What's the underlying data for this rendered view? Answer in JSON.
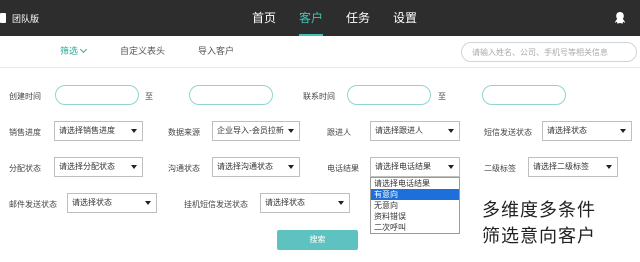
{
  "app": {
    "brand_label": "团队版"
  },
  "nav": [
    {
      "label": "首页"
    },
    {
      "label": "客户"
    },
    {
      "label": "任务"
    },
    {
      "label": "设置"
    }
  ],
  "subnav": {
    "filter": "筛选",
    "custom_header": "自定义表头",
    "import": "导入客户",
    "search_placeholder": "请输入姓名、公司、手机号等相关信息"
  },
  "filters": {
    "created_time": "创建时间",
    "contact_time": "联系时间",
    "to": "至",
    "sales_progress": {
      "label": "销售进度",
      "value": "请选择销售进度"
    },
    "data_source": {
      "label": "数据来源",
      "value": "企业导入-会员拉新"
    },
    "follower": {
      "label": "跟进人",
      "value": "请选择跟进人"
    },
    "sms_status": {
      "label": "短信发送状态",
      "value": "请选择状态"
    },
    "assign_status": {
      "label": "分配状态",
      "value": "请选择分配状态"
    },
    "comm_status": {
      "label": "沟通状态",
      "value": "请选择沟通状态"
    },
    "call_result": {
      "label": "电话结果",
      "value": "请选择电话结果"
    },
    "secondary_tag": {
      "label": "二级标签",
      "value": "请选择二级标签"
    },
    "mail_status": {
      "label": "邮件发送状态",
      "value": "请选择状态"
    },
    "robot_sms_status": {
      "label": "挂机短信发送状态",
      "value": "请选择状态"
    }
  },
  "dropdown": {
    "options": [
      "请选择电话结果",
      "有意向",
      "无意向",
      "资料错误",
      "二次呼叫"
    ],
    "highlighted_index": 1
  },
  "overlay_text": [
    "多维度多条件",
    "筛选意向客户"
  ],
  "search_button": "搜索",
  "colors": {
    "accent": "#3fc4b4",
    "topbar": "#2d2d2d",
    "highlight": "#1e6fd9",
    "button": "#5ec3c0"
  }
}
